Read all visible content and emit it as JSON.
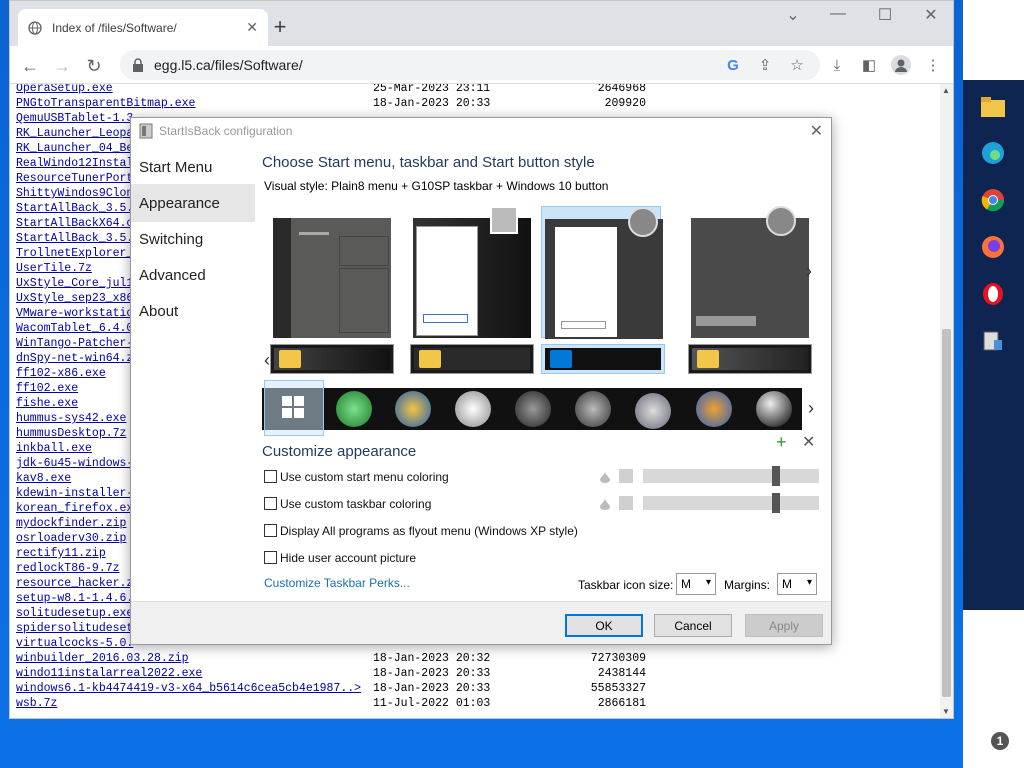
{
  "browser": {
    "tab_title": "Index of /files/Software/",
    "url": "egg.l5.ca/files/Software/",
    "new_tab": "+",
    "close_tab": "✕"
  },
  "files": [
    {
      "name": "OperaSetup.exe",
      "date": "25-Mar-2023 23:11",
      "size": "2646968"
    },
    {
      "name": "PNGtoTransparentBitmap.exe",
      "date": "18-Jan-2023 20:33",
      "size": "209920"
    },
    {
      "name": "QemuUSBTablet-1.3",
      "date": "",
      "size": ""
    },
    {
      "name": "RK_Launcher_Leopa",
      "date": "",
      "size": ""
    },
    {
      "name": "RK_Launcher_04_Be",
      "date": "",
      "size": ""
    },
    {
      "name": "RealWindo12Instal",
      "date": "",
      "size": ""
    },
    {
      "name": "ResourceTunerPort",
      "date": "",
      "size": ""
    },
    {
      "name": "ShittyWindos9Clon",
      "date": "",
      "size": ""
    },
    {
      "name": "StartAllBack_3.5.",
      "date": "",
      "size": ""
    },
    {
      "name": "StartAllBackX64.c",
      "date": "",
      "size": ""
    },
    {
      "name": "StartAllBack_3.5.",
      "date": "",
      "size": ""
    },
    {
      "name": "TrollnetExplorer_",
      "date": "",
      "size": ""
    },
    {
      "name": "UserTile.7z",
      "date": "",
      "size": ""
    },
    {
      "name": "UxStyle_Core_jul1",
      "date": "",
      "size": ""
    },
    {
      "name": "UxStyle_sep23_x86",
      "date": "",
      "size": ""
    },
    {
      "name": "VMware-workstatio",
      "date": "",
      "size": ""
    },
    {
      "name": "WacomTablet_6.4.0",
      "date": "",
      "size": ""
    },
    {
      "name": "WinTango-Patcher-",
      "date": "",
      "size": ""
    },
    {
      "name": "dnSpy-net-win64.z",
      "date": "",
      "size": ""
    },
    {
      "name": "ff102-x86.exe",
      "date": "",
      "size": ""
    },
    {
      "name": "ff102.exe",
      "date": "",
      "size": ""
    },
    {
      "name": "fishe.exe",
      "date": "",
      "size": ""
    },
    {
      "name": "hummus-sys42.exe",
      "date": "",
      "size": ""
    },
    {
      "name": "hummusDesktop.7z",
      "date": "",
      "size": ""
    },
    {
      "name": "inkball.exe",
      "date": "",
      "size": ""
    },
    {
      "name": "jdk-6u45-windows-",
      "date": "",
      "size": ""
    },
    {
      "name": "kav8.exe",
      "date": "",
      "size": ""
    },
    {
      "name": "kdewin-installer-",
      "date": "",
      "size": ""
    },
    {
      "name": "korean_firefox.ex",
      "date": "",
      "size": ""
    },
    {
      "name": "mydockfinder.zip",
      "date": "",
      "size": ""
    },
    {
      "name": "osrloaderv30.zip",
      "date": "",
      "size": ""
    },
    {
      "name": "rectify11.zip",
      "date": "",
      "size": ""
    },
    {
      "name": "redlockT86-9.7z",
      "date": "",
      "size": ""
    },
    {
      "name": "resource_hacker.z",
      "date": "",
      "size": ""
    },
    {
      "name": "setup-w8.1-1.4.6.",
      "date": "",
      "size": ""
    },
    {
      "name": "solitudesetup.exe",
      "date": "",
      "size": ""
    },
    {
      "name": "spidersolitudeset",
      "date": "",
      "size": ""
    },
    {
      "name": "virtualcocks-5.0.",
      "date": "",
      "size": ""
    },
    {
      "name": "winbuilder_2016.03.28.zip",
      "date": "18-Jan-2023 20:32",
      "size": "72730309"
    },
    {
      "name": "windo11instalarreal2022.exe",
      "date": "18-Jan-2023 20:33",
      "size": "2438144"
    },
    {
      "name": "windows6.1-kb4474419-v3-x64_b5614c6cea5cb4e1987..>",
      "date": "18-Jan-2023 20:33",
      "size": "55853327"
    },
    {
      "name": "wsb.7z",
      "date": "11-Jul-2022 01:03",
      "size": "2866181"
    }
  ],
  "dialog": {
    "title": "StartIsBack configuration",
    "nav": [
      "Start Menu",
      "Appearance",
      "Switching",
      "Advanced",
      "About"
    ],
    "heading": "Choose Start menu, taskbar and Start button style",
    "visual_style": "Visual style:  Plain8 menu + G10SP taskbar + Windows 10 button",
    "customize_heading": "Customize appearance",
    "options": [
      "Use custom start menu coloring",
      "Use custom taskbar coloring",
      "Display All programs as flyout menu (Windows XP style)",
      "Hide user account picture"
    ],
    "perks_link": "Customize Taskbar Perks...",
    "taskbar_icon_size_label": "Taskbar icon size:",
    "taskbar_icon_size_value": "M",
    "margins_label": "Margins:",
    "margins_value": "M",
    "ok": "OK",
    "cancel": "Cancel",
    "apply": "Apply"
  },
  "colors": {
    "accent": "#0078d7",
    "link": "#1a6fb3",
    "heading": "#1f3a5f"
  }
}
